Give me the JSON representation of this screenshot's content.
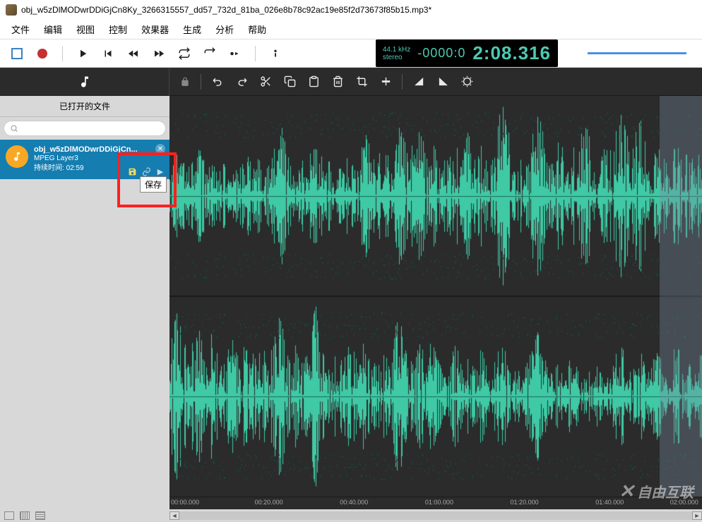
{
  "title": "obj_w5zDlMODwrDDiGjCn8Ky_3266315557_dd57_732d_81ba_026e8b78c92ac19e85f2d73673f85b15.mp3*",
  "menus": [
    "文件",
    "编辑",
    "视图",
    "控制",
    "效果器",
    "生成",
    "分析",
    "帮助"
  ],
  "toolbar": {
    "sample_rate": "44.1 kHz",
    "channels": "stereo",
    "time_prefix": "-0000:0",
    "time_main": "2:08.316"
  },
  "sidebar": {
    "header": "已打开的文件",
    "search_placeholder": "",
    "file": {
      "name": "obj_w5zDlMODwrDDiGjCn...",
      "format": "MPEG Layer3",
      "duration_label": "持续时间:",
      "duration": "02:59"
    }
  },
  "tooltip": "保存",
  "ruler": [
    "00:00.000",
    "00:20.000",
    "00:40.000",
    "01:00.000",
    "01:20.000",
    "01:40.000",
    "02:00.000"
  ],
  "watermark": "自由互联"
}
